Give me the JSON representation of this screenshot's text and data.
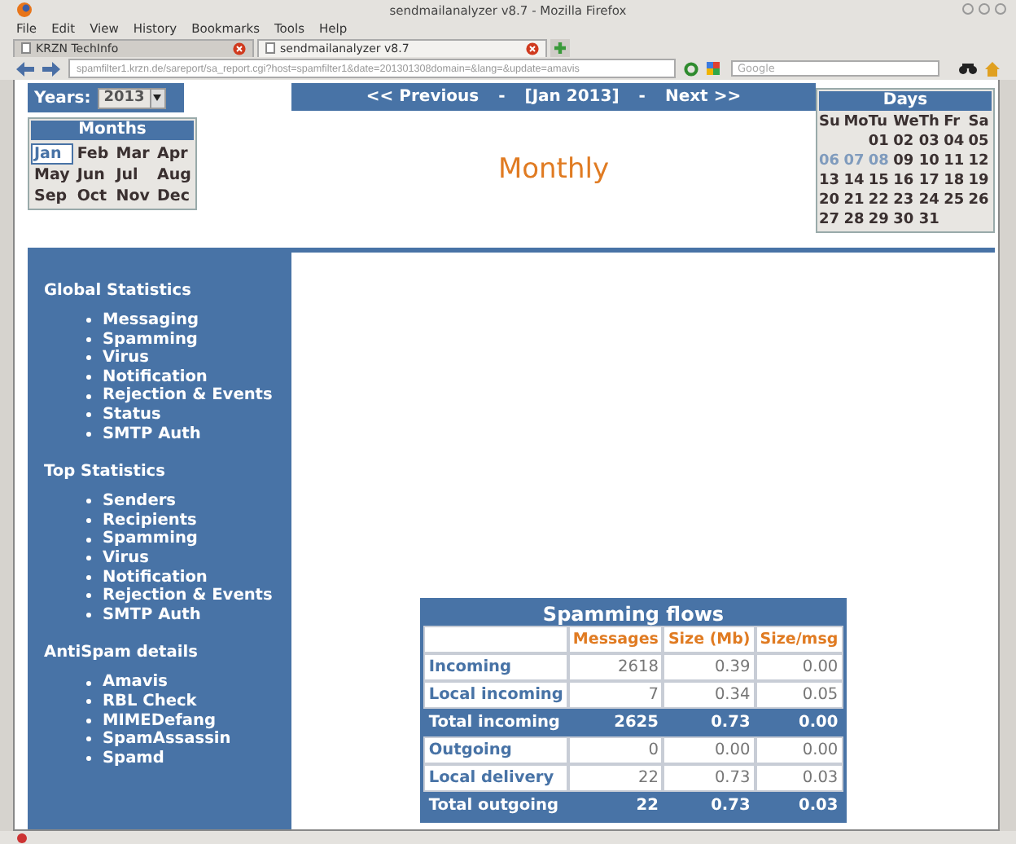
{
  "window": {
    "title": "sendmailanalyzer v8.7 - Mozilla Firefox"
  },
  "menu": [
    "File",
    "Edit",
    "View",
    "History",
    "Bookmarks",
    "Tools",
    "Help"
  ],
  "tabs": [
    {
      "label": "KRZN TechInfo",
      "selected": false
    },
    {
      "label": "sendmailanalyzer v8.7",
      "selected": true
    }
  ],
  "address_bar": {
    "value": "spamfilter1.krzn.de/sareport/sa_report.cgi?host=spamfilter1&date=201301308domain=&lang=&update=amavis"
  },
  "search": {
    "placeholder": "Google"
  },
  "years": {
    "label": "Years:",
    "value": "2013"
  },
  "months": {
    "title": "Months",
    "items": [
      {
        "label": "Jan",
        "selected": true
      },
      {
        "label": "Feb",
        "selected": false
      },
      {
        "label": "Mar",
        "selected": false
      },
      {
        "label": "Apr",
        "selected": false
      },
      {
        "label": "May",
        "selected": false
      },
      {
        "label": "Jun",
        "selected": false
      },
      {
        "label": "Jul",
        "selected": false
      },
      {
        "label": "Aug",
        "selected": false
      },
      {
        "label": "Sep",
        "selected": false
      },
      {
        "label": "Oct",
        "selected": false
      },
      {
        "label": "Nov",
        "selected": false
      },
      {
        "label": "Dec",
        "selected": false
      }
    ]
  },
  "nav": {
    "previous": "<< Previous",
    "sep1": "-",
    "current": "[Jan 2013]",
    "sep2": "-",
    "next": "Next >>"
  },
  "heading": "Monthly",
  "days": {
    "title": "Days",
    "weekdays": [
      "Su",
      "Mo",
      "Tu",
      "We",
      "Th",
      "Fr",
      "Sa"
    ],
    "weeks": [
      [
        {
          "label": "01",
          "dimmed": false
        },
        {
          "label": "02",
          "dimmed": false
        },
        {
          "label": "03",
          "dimmed": false
        },
        {
          "label": "04",
          "dimmed": false
        },
        {
          "label": "05",
          "dimmed": false
        }
      ],
      [
        {
          "label": "06",
          "dimmed": true
        },
        {
          "label": "07",
          "dimmed": true
        },
        {
          "label": "08",
          "dimmed": true
        },
        {
          "label": "09",
          "dimmed": false
        },
        {
          "label": "10",
          "dimmed": false
        },
        {
          "label": "11",
          "dimmed": false
        },
        {
          "label": "12",
          "dimmed": false
        }
      ],
      [
        {
          "label": "13",
          "dimmed": false
        },
        {
          "label": "14",
          "dimmed": false
        },
        {
          "label": "15",
          "dimmed": false
        },
        {
          "label": "16",
          "dimmed": false
        },
        {
          "label": "17",
          "dimmed": false
        },
        {
          "label": "18",
          "dimmed": false
        },
        {
          "label": "19",
          "dimmed": false
        }
      ],
      [
        {
          "label": "20",
          "dimmed": false
        },
        {
          "label": "21",
          "dimmed": false
        },
        {
          "label": "22",
          "dimmed": false
        },
        {
          "label": "23",
          "dimmed": false
        },
        {
          "label": "24",
          "dimmed": false
        },
        {
          "label": "25",
          "dimmed": false
        },
        {
          "label": "26",
          "dimmed": false
        }
      ],
      [
        {
          "label": "27",
          "dimmed": false
        },
        {
          "label": "28",
          "dimmed": false
        },
        {
          "label": "29",
          "dimmed": false
        },
        {
          "label": "30",
          "dimmed": false
        },
        {
          "label": "31",
          "dimmed": false
        }
      ]
    ]
  },
  "sidebar": {
    "sections": [
      {
        "title": "Global Statistics",
        "items": [
          "Messaging",
          "Spamming",
          "Virus",
          "Notification",
          "Rejection & Events",
          "Status",
          "SMTP Auth"
        ]
      },
      {
        "title": "Top Statistics",
        "items": [
          "Senders",
          "Recipients",
          "Spamming",
          "Virus",
          "Notification",
          "Rejection & Events",
          "SMTP Auth"
        ]
      },
      {
        "title": "AntiSpam details",
        "items": [
          "Amavis",
          "RBL Check",
          "MIMEDefang",
          "SpamAssassin",
          "Spamd"
        ]
      }
    ]
  },
  "table": {
    "title": "Spamming flows",
    "columns": [
      "Messages",
      "Size (Mb)",
      "Size/msg"
    ],
    "rows": [
      {
        "kind": "normal",
        "label": "Incoming",
        "cells": [
          "2618",
          "0.39",
          "0.00"
        ]
      },
      {
        "kind": "normal",
        "label": "Local incoming",
        "cells": [
          "7",
          "0.34",
          "0.05"
        ]
      },
      {
        "kind": "total",
        "label": "Total incoming",
        "cells": [
          "2625",
          "0.73",
          "0.00"
        ]
      },
      {
        "kind": "normal",
        "label": "Outgoing",
        "cells": [
          "0",
          "0.00",
          "0.00"
        ]
      },
      {
        "kind": "normal",
        "label": "Local delivery",
        "cells": [
          "22",
          "0.73",
          "0.03"
        ]
      },
      {
        "kind": "total",
        "label": "Total outgoing",
        "cells": [
          "22",
          "0.73",
          "0.03"
        ]
      }
    ]
  }
}
